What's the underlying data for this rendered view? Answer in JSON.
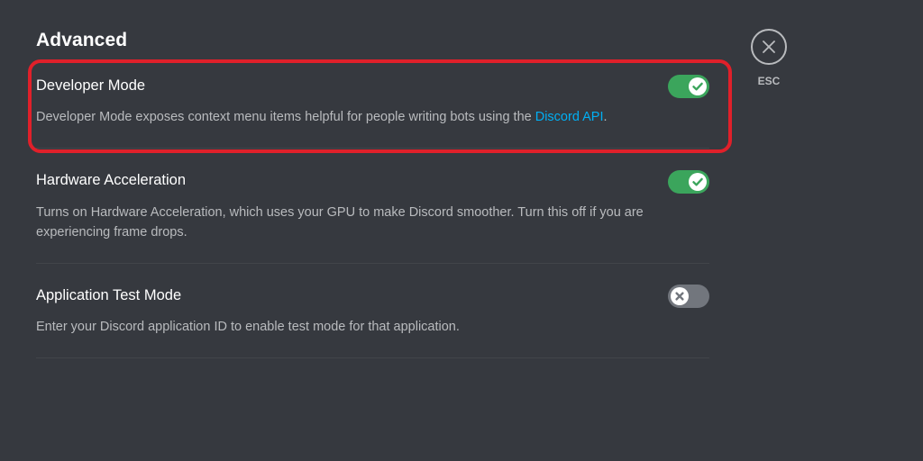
{
  "section": {
    "title": "Advanced"
  },
  "settings": [
    {
      "title": "Developer Mode",
      "description_prefix": "Developer Mode exposes context menu items helpful for people writing bots using the ",
      "link_text": "Discord API",
      "description_suffix": ".",
      "enabled": true
    },
    {
      "title": "Hardware Acceleration",
      "description": "Turns on Hardware Acceleration, which uses your GPU to make Discord smoother. Turn this off if you are experiencing frame drops.",
      "enabled": true
    },
    {
      "title": "Application Test Mode",
      "description": "Enter your Discord application ID to enable test mode for that application.",
      "enabled": false
    }
  ],
  "close": {
    "label": "ESC",
    "icon": "close-icon"
  },
  "colors": {
    "background": "#36393f",
    "toggle_on": "#3ba55c",
    "toggle_off": "#72767d",
    "link": "#00aff4",
    "highlight": "#e0202a"
  }
}
